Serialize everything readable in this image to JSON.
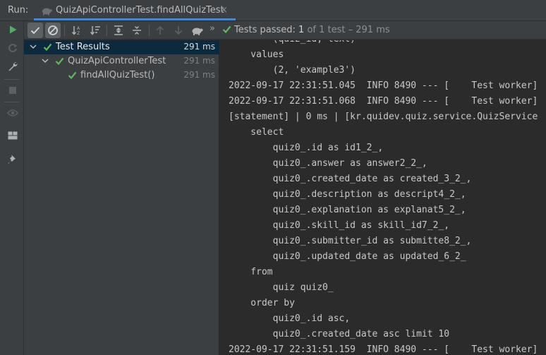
{
  "header": {
    "run_label": "Run:",
    "tab_title": "QuizApiControllerTest.findAllQuizTest",
    "close_glyph": "×"
  },
  "toolbar": {
    "overflow_glyph": "»",
    "status_prefix": "Tests passed: ",
    "status_passed": "1",
    "status_rest": " of 1 test – 291 ms"
  },
  "tree": {
    "items": [
      {
        "label": "Test Results",
        "time": "291 ms"
      },
      {
        "label": "QuizApiControllerTest",
        "time": "291 ms"
      },
      {
        "label": "findAllQuizTest()",
        "time": "291 ms"
      }
    ]
  },
  "console": {
    "lines": [
      "        (quiz_id, text)",
      "    values",
      "        (2, 'example3')",
      "2022-09-17 22:31:51.045  INFO 8490 --- [    Test worker]",
      "2022-09-17 22:31:51.068  INFO 8490 --- [    Test worker]",
      "[statement] | 0 ms | [kr.quidev.quiz.service.QuizService",
      "    select",
      "        quiz0_.id as id1_2_,",
      "        quiz0_.answer as answer2_2_,",
      "        quiz0_.created_date as created_3_2_,",
      "        quiz0_.description as descript4_2_,",
      "        quiz0_.explanation as explanat5_2_,",
      "        quiz0_.skill_id as skill_id7_2_,",
      "        quiz0_.submitter_id as submitte8_2_,",
      "        quiz0_.updated_date as updated_6_2_",
      "    from",
      "        quiz quiz0_",
      "    order by",
      "        quiz0_.id asc,",
      "        quiz0_.created_date asc limit 10",
      "2022-09-17 22:31:51.159  INFO 8490 --- [    Test worker]"
    ]
  },
  "icons": {
    "run": "play-icon",
    "rerun_failed": "rerun-failed-icon",
    "settings": "wrench-icon",
    "stop": "stop-icon",
    "view": "eye-icon",
    "layout": "layout-icon",
    "pin": "pin-icon",
    "show_passed": "check-icon",
    "show_ignored": "ignored-icon",
    "sort_alpha": "sort-alphabetically-icon",
    "sort_duration": "sort-by-duration-icon",
    "expand_all": "expand-all-icon",
    "collapse_all": "collapse-all-icon",
    "previous": "arrow-up-icon",
    "next": "arrow-down-icon",
    "import": "import-tests-icon",
    "passed": "passed-check-icon"
  },
  "colors": {
    "passed": "#5fb85c",
    "run": "#59a869",
    "accent_underline": "#4a88c7",
    "selection": "#0d293e"
  }
}
